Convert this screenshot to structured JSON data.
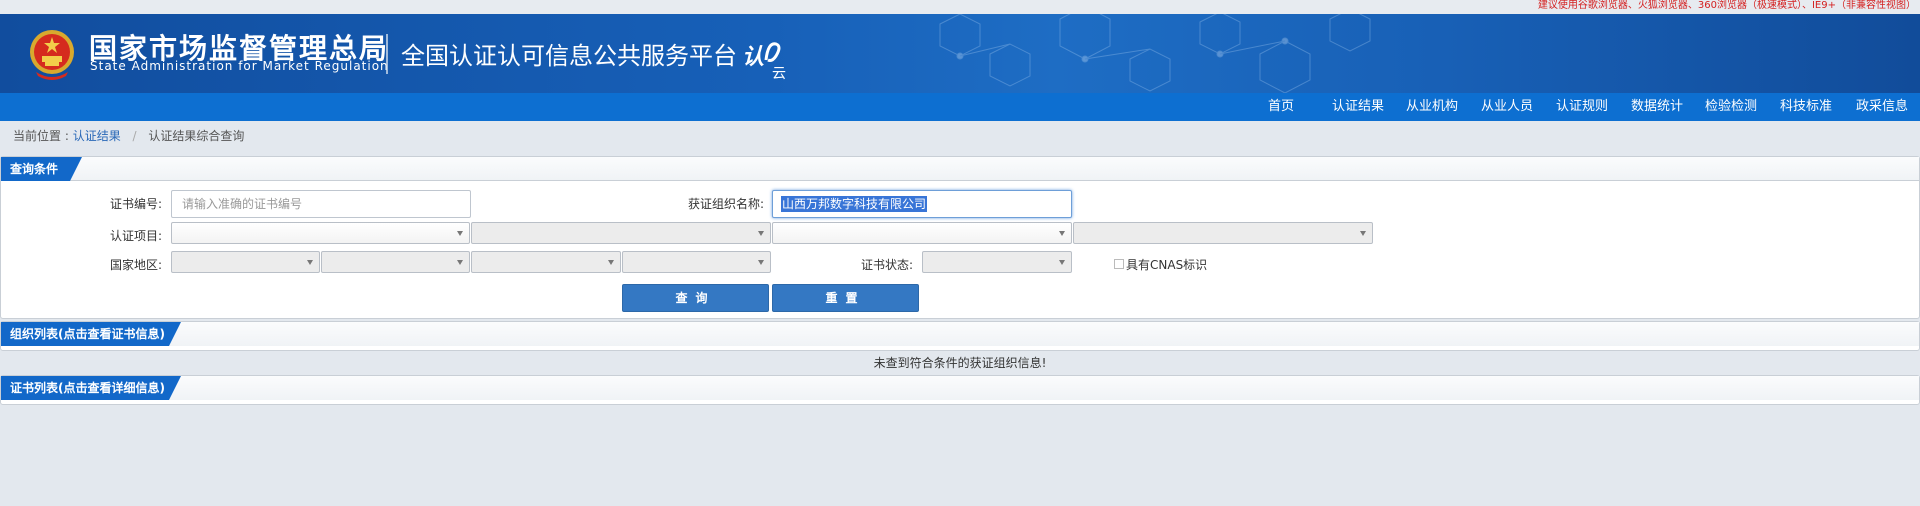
{
  "browser_notice": "建议使用谷歌浏览器、火狐浏览器、360浏览器（极速模式）、IE9+（非兼容性视图）",
  "header": {
    "emblem_icon": "national-emblem-icon",
    "site_name_cn": "国家市场监督管理总局",
    "site_name_en": "State Administration  for  Market Regulation",
    "platform_name": "全国认证认可信息公共服务平台",
    "logo_icon": "renzheng-cloud-logo-icon"
  },
  "nav": {
    "items": [
      "首页",
      "认证结果",
      "从业机构",
      "从业人员",
      "认证规则",
      "数据统计",
      "检验检测",
      "科技标准",
      "政采信息"
    ]
  },
  "breadcrumb": {
    "prefix": "当前位置 :",
    "link": "认证结果",
    "separator": "/",
    "current": "认证结果综合查询"
  },
  "query_panel": {
    "title": "查询条件",
    "cert_number_label": "证书编号:",
    "cert_number_placeholder": "请输入准确的证书编号",
    "org_name_label": "获证组织名称:",
    "org_name_value": "山西万邦数字科技有限公司",
    "cert_project_label": "认证项目:",
    "region_label": "国家地区:",
    "cert_status_label": "证书状态:",
    "cnas_label": "具有CNAS标识",
    "search_button": "查询",
    "reset_button": "重置"
  },
  "org_list": {
    "title": "组织列表(点击查看证书信息)",
    "empty_message": "未查到符合条件的获证组织信息!"
  },
  "cert_list": {
    "title": "证书列表(点击查看详细信息)"
  },
  "colors": {
    "banner_blue": "#1760b8",
    "nav_blue": "#0d6fd1",
    "tab_blue": "#1268c9",
    "button_blue": "#3478c3",
    "notice_red": "#d42020"
  }
}
